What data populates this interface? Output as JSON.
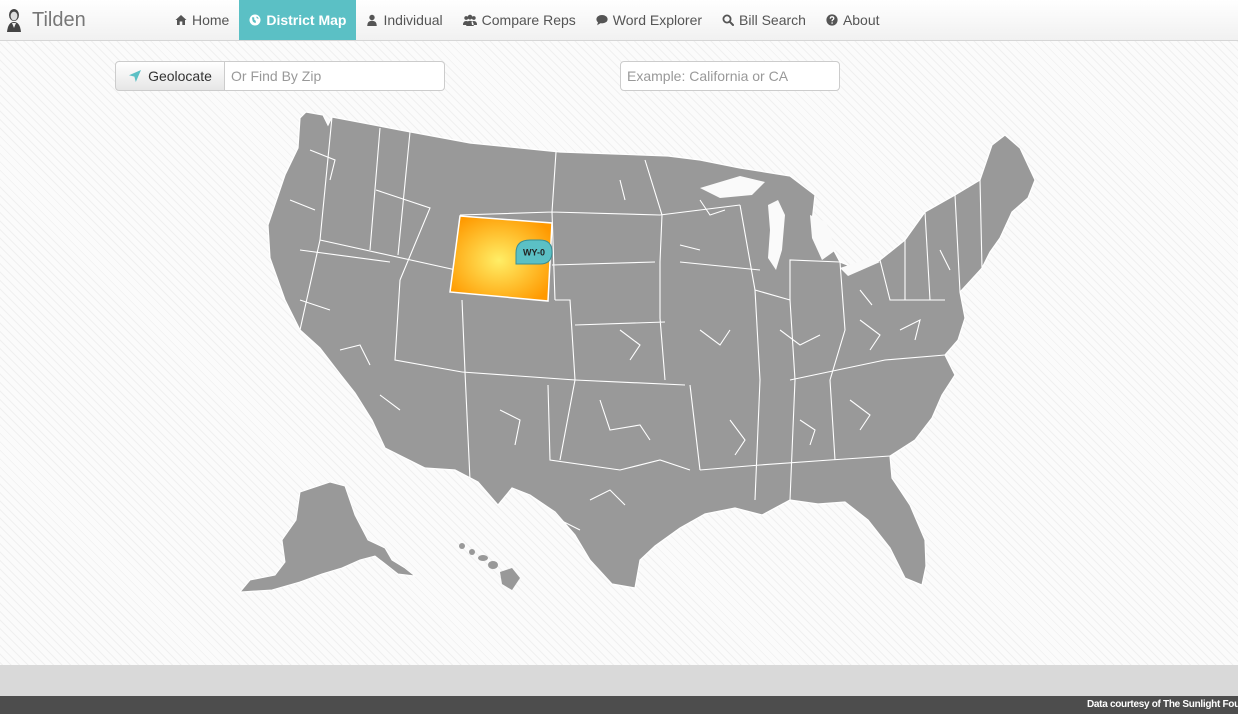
{
  "app": {
    "title": "Tilden"
  },
  "nav": {
    "items": [
      {
        "label": "Home",
        "icon": "home-icon"
      },
      {
        "label": "District Map",
        "icon": "globe-icon",
        "active": true
      },
      {
        "label": "Individual",
        "icon": "user-icon"
      },
      {
        "label": "Compare Reps",
        "icon": "users-icon"
      },
      {
        "label": "Word Explorer",
        "icon": "comment-icon"
      },
      {
        "label": "Bill Search",
        "icon": "search-icon"
      },
      {
        "label": "About",
        "icon": "question-circle-icon"
      }
    ]
  },
  "toolbar": {
    "geolocate_label": "Geolocate",
    "zip_placeholder": "Or Find By Zip",
    "state_placeholder": "Example: California or CA"
  },
  "map": {
    "selected_district": "WY-0",
    "colors": {
      "land": "#999999",
      "borders": "#ffffff",
      "highlight_center": "#ffee66",
      "highlight_edge": "#ff9900",
      "badge": "#5bc0c5",
      "accent": "#5bc0c5"
    }
  },
  "footer": {
    "credit": "Data courtesy of The Sunlight Foundation"
  }
}
